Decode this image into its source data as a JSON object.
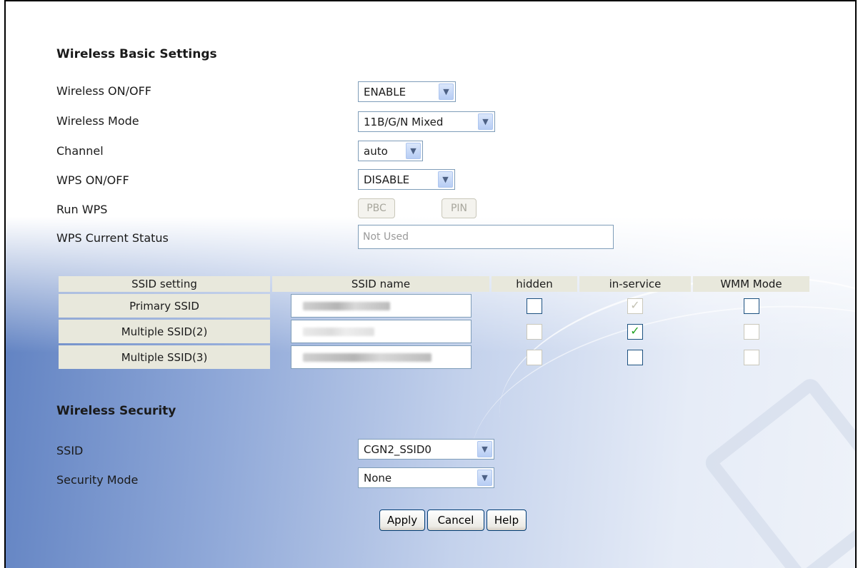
{
  "basic": {
    "heading": "Wireless Basic Settings",
    "wireless_onoff_label": "Wireless ON/OFF",
    "wireless_onoff_value": "ENABLE",
    "wireless_mode_label": "Wireless Mode",
    "wireless_mode_value": "11B/G/N Mixed",
    "channel_label": "Channel",
    "channel_value": "auto",
    "wps_onoff_label": "WPS ON/OFF",
    "wps_onoff_value": "DISABLE",
    "run_wps_label": "Run WPS",
    "pbc_label": "PBC",
    "pin_label": "PIN",
    "wps_status_label": "WPS Current Status",
    "wps_status_value": "Not Used"
  },
  "ssid_table": {
    "headers": [
      "SSID setting",
      "SSID name",
      "hidden",
      "in-service",
      "WMM Mode"
    ],
    "rows": [
      {
        "setting": "Primary SSID",
        "hidden": false,
        "in_service": true,
        "wmm": false
      },
      {
        "setting": "Multiple SSID(2)",
        "hidden": false,
        "in_service": true,
        "wmm": false
      },
      {
        "setting": "Multiple SSID(3)",
        "hidden": false,
        "in_service": false,
        "wmm": false
      }
    ]
  },
  "security": {
    "heading": "Wireless Security",
    "ssid_label": "SSID",
    "ssid_value": "CGN2_SSID0",
    "mode_label": "Security Mode",
    "mode_value": "None"
  },
  "buttons": {
    "apply": "Apply",
    "cancel": "Cancel",
    "help": "Help"
  },
  "icons": {
    "dropdown": "chevron-down-icon",
    "check": "check-icon"
  },
  "colors": {
    "gradient_left": "#5d7fc0",
    "label_cell": "#e8e8dc",
    "check_green": "#21a121"
  }
}
